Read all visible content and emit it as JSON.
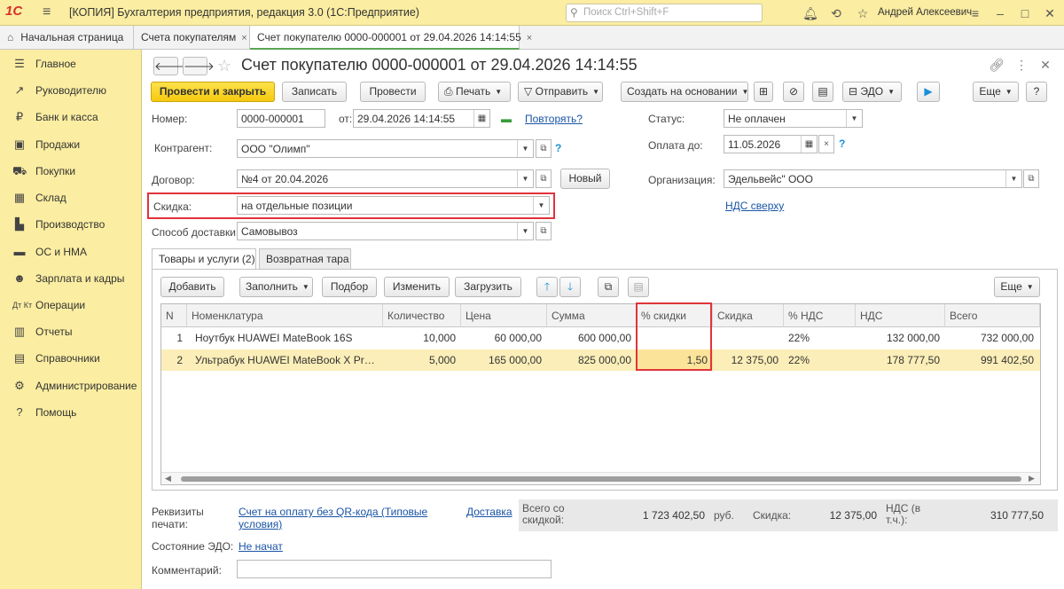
{
  "titlebar": {
    "logo": "1С",
    "title": "[КОПИЯ] Бухгалтерия предприятия, редакция 3.0  (1С:Предприятие)",
    "search_placeholder": "Поиск Ctrl+Shift+F",
    "user": "Андрей Алексеевич"
  },
  "tabs": [
    {
      "label": "Начальная страница"
    },
    {
      "label": "Счета покупателям"
    },
    {
      "label": "Счет покупателю 0000-000001 от 29.04.2026 14:14:55"
    }
  ],
  "sidebar": {
    "items": [
      {
        "label": "Главное",
        "icon": "menu-icon"
      },
      {
        "label": "Руководителю",
        "icon": "chart-icon"
      },
      {
        "label": "Банк и касса",
        "icon": "ruble-icon"
      },
      {
        "label": "Продажи",
        "icon": "bag-icon"
      },
      {
        "label": "Покупки",
        "icon": "cart-icon"
      },
      {
        "label": "Склад",
        "icon": "warehouse-icon"
      },
      {
        "label": "Производство",
        "icon": "factory-icon"
      },
      {
        "label": "ОС и НМА",
        "icon": "assets-icon"
      },
      {
        "label": "Зарплата и кадры",
        "icon": "people-icon"
      },
      {
        "label": "Операции",
        "icon": "operations-icon"
      },
      {
        "label": "Отчеты",
        "icon": "reports-icon"
      },
      {
        "label": "Справочники",
        "icon": "books-icon"
      },
      {
        "label": "Администрирование",
        "icon": "gear-icon"
      },
      {
        "label": "Помощь",
        "icon": "help-icon"
      }
    ]
  },
  "doc": {
    "title": "Счет покупателю 0000-000001 от 29.04.2026 14:14:55"
  },
  "toolbar": {
    "post_close": "Провести и закрыть",
    "save": "Записать",
    "post": "Провести",
    "print": "Печать",
    "send": "Отправить",
    "create_based": "Создать на основании",
    "edo": "ЭДО",
    "more": "Еще",
    "help": "?"
  },
  "form": {
    "number_label": "Номер:",
    "number": "0000-000001",
    "date_label": "от:",
    "date": "29.04.2026 14:14:55",
    "repeat_link": "Повторять?",
    "status_label": "Статус:",
    "status": "Не оплачен",
    "counterparty_label": "Контрагент:",
    "counterparty": "ООО \"Олимп\"",
    "pay_until_label": "Оплата до:",
    "pay_until": "11.05.2026",
    "contract_label": "Договор:",
    "contract": "№4 от 20.04.2026",
    "new_button": "Новый",
    "org_label": "Организация:",
    "org": "Эдельвейс\" ООО",
    "discount_label": "Скидка:",
    "discount": "на отдельные позиции",
    "vat_link": "НДС сверху",
    "delivery_label": "Способ доставки:",
    "delivery": "Самовывоз"
  },
  "doc_tabs": [
    {
      "label": "Товары и услуги (2)"
    },
    {
      "label": "Возвратная тара"
    }
  ],
  "table_toolbar": {
    "add": "Добавить",
    "fill": "Заполнить",
    "pick": "Подбор",
    "change": "Изменить",
    "load": "Загрузить",
    "more": "Еще"
  },
  "table": {
    "columns": [
      "N",
      "Номенклатура",
      "Количество",
      "Цена",
      "Сумма",
      "% скидки",
      "Скидка",
      "% НДС",
      "НДС",
      "Всего"
    ],
    "rows": [
      [
        "1",
        "Ноутбук HUAWEI MateBook 16S",
        "10,000",
        "60 000,00",
        "600 000,00",
        "",
        "",
        "22%",
        "132 000,00",
        "732 000,00"
      ],
      [
        "2",
        "Ультрабук HUAWEI MateBook X Pro ...",
        "5,000",
        "165 000,00",
        "825 000,00",
        "1,50",
        "12 375,00",
        "22%",
        "178 777,50",
        "991 402,50"
      ]
    ]
  },
  "footer": {
    "print_details_label": "Реквизиты печати:",
    "print_details_link": "Счет на оплату без QR-кода (Типовые условия)",
    "delivery_link": "Доставка",
    "total_label": "Всего со скидкой:",
    "total": "1 723 402,50",
    "currency": "руб.",
    "discount_label": "Скидка:",
    "discount": "12 375,00",
    "vat_label": "НДС (в т.ч.):",
    "vat": "310 777,50",
    "edo_state_label": "Состояние ЭДО:",
    "edo_state": "Не начат",
    "comment_label": "Комментарий:",
    "comment": ""
  }
}
